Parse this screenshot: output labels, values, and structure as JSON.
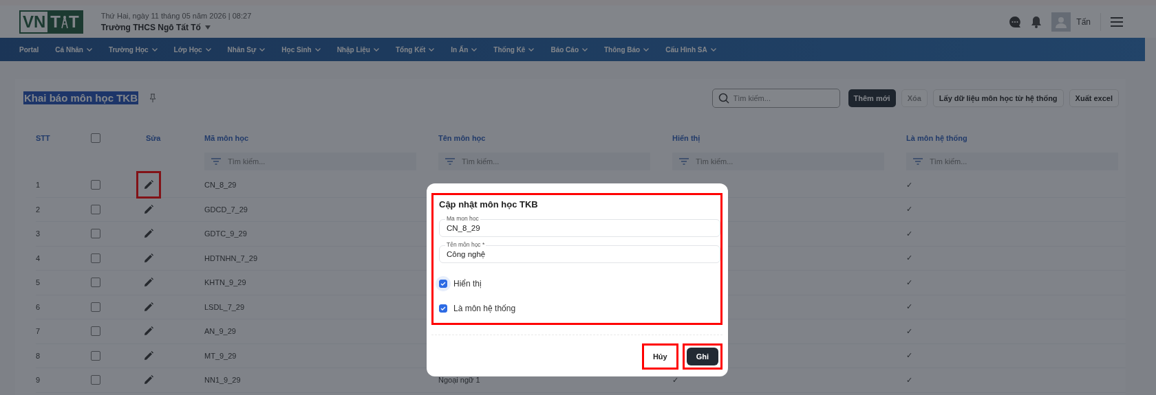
{
  "header": {
    "logo": [
      "VN",
      "T",
      "T"
    ],
    "date": "Thứ Hai, ngày 11 tháng 05 năm 2026 | 08:27",
    "school": "Trường THCS Ngô Tất Tố",
    "user": "Tấn"
  },
  "nav": [
    {
      "label": "Portal",
      "dropdown": false
    },
    {
      "label": "Cá Nhân",
      "dropdown": true
    },
    {
      "label": "Trường Học",
      "dropdown": true
    },
    {
      "label": "Lớp Học",
      "dropdown": true
    },
    {
      "label": "Nhân Sự",
      "dropdown": true
    },
    {
      "label": "Học Sinh",
      "dropdown": true
    },
    {
      "label": "Nhập Liệu",
      "dropdown": true
    },
    {
      "label": "Tổng Kết",
      "dropdown": true
    },
    {
      "label": "In Ấn",
      "dropdown": true
    },
    {
      "label": "Thống Kê",
      "dropdown": true
    },
    {
      "label": "Báo Cáo",
      "dropdown": true
    },
    {
      "label": "Thông Báo",
      "dropdown": true
    },
    {
      "label": "Cấu Hình SA",
      "dropdown": true
    }
  ],
  "page": {
    "title": "Khai báo môn học TKB",
    "search_placeholder": "Tìm kiếm...",
    "buttons": [
      {
        "label": "Thêm mới",
        "kind": "primary"
      },
      {
        "label": "Xóa",
        "kind": "disabled"
      },
      {
        "label": "Lấy dữ liệu môn học từ hệ thống",
        "kind": "outline"
      },
      {
        "label": "Xuất excel",
        "kind": "outline"
      }
    ]
  },
  "table": {
    "columns": [
      "STT",
      "Sửa",
      "Mã môn học",
      "Tên môn học",
      "Hiển thị",
      "Là môn hệ thống"
    ],
    "select_all_checked": false,
    "filter_placeholders": [
      "Tìm kiếm...",
      "Tìm kiếm...",
      "Tìm kiếm...",
      "Tìm kiếm..."
    ],
    "rows": [
      {
        "stt": "1",
        "checked": false,
        "code": "CN_8_29",
        "system": "✓",
        "edit_highlighted": true
      },
      {
        "stt": "2",
        "checked": false,
        "code": "GDCD_7_29",
        "system": "✓",
        "edit_highlighted": false
      },
      {
        "stt": "3",
        "checked": false,
        "code": "GDTC_9_29",
        "system": "✓",
        "edit_highlighted": false
      },
      {
        "stt": "4",
        "checked": false,
        "code": "HDTNHN_7_29",
        "system": "✓",
        "edit_highlighted": false
      },
      {
        "stt": "5",
        "checked": false,
        "code": "KHTN_9_29",
        "system": "✓",
        "edit_highlighted": false
      },
      {
        "stt": "6",
        "checked": false,
        "code": "LSDL_7_29",
        "system": "✓",
        "edit_highlighted": false
      },
      {
        "stt": "7",
        "checked": false,
        "code": "AN_9_29",
        "system": "✓",
        "edit_highlighted": false
      },
      {
        "stt": "8",
        "checked": false,
        "code": "MT_9_29",
        "system": "✓",
        "edit_highlighted": false
      },
      {
        "stt": "9",
        "checked": false,
        "code": "NN1_9_29",
        "name": "Ngoại ngữ 1",
        "shown": "✓",
        "system": "✓",
        "edit_highlighted": false
      }
    ]
  },
  "modal": {
    "title": "Cập nhật môn học TKB",
    "highlighted": true,
    "fields": [
      {
        "label": "Ma mon hoc",
        "value": "CN_8_29"
      },
      {
        "label": "Tên môn học *",
        "value": "Công nghệ"
      }
    ],
    "checkboxes": [
      {
        "label": "Hiển thị",
        "checked": true,
        "focused": true
      },
      {
        "label": "Là môn hệ thống",
        "checked": true,
        "focused": false
      }
    ],
    "buttons": [
      {
        "label": "Hủy",
        "kind": "text",
        "highlighted": true
      },
      {
        "label": "Ghi",
        "kind": "primary",
        "highlighted": true
      }
    ]
  }
}
